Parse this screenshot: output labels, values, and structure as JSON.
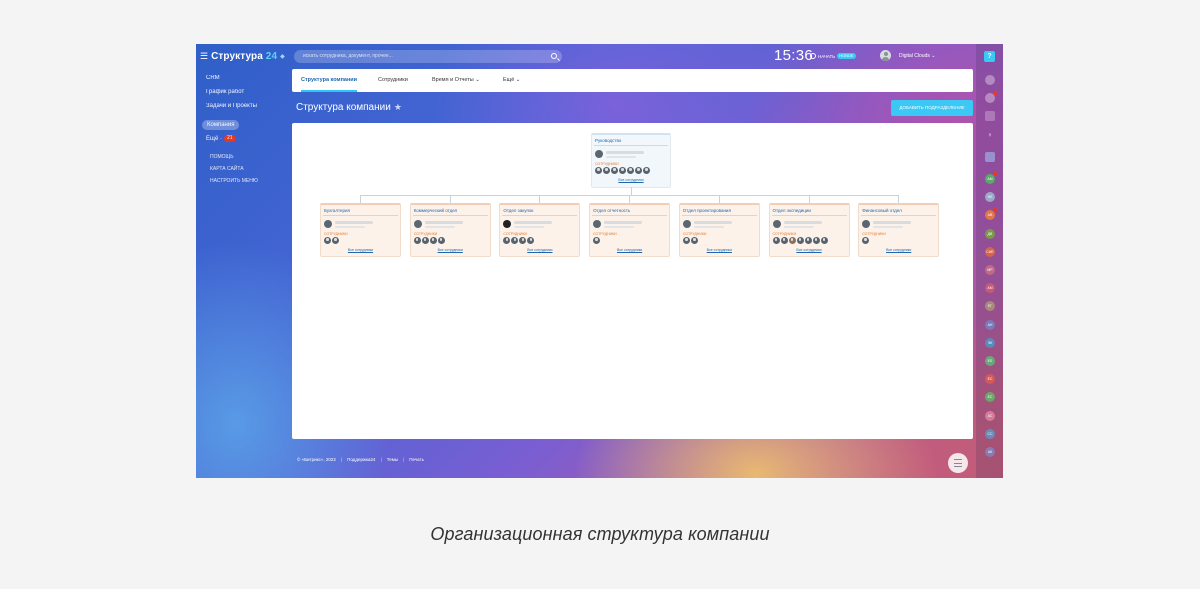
{
  "sidebar": {
    "logo_text": "Структура",
    "logo_num": "24",
    "items": [
      {
        "label": "CRM"
      },
      {
        "label": "График работ"
      },
      {
        "label": "Задачи и Проекты"
      },
      {
        "label": "Компания"
      },
      {
        "label": "Ещё"
      }
    ],
    "more_count": "21",
    "secondary": [
      {
        "label": "ПОМОЩЬ"
      },
      {
        "label": "КАРТА САЙТА"
      },
      {
        "label": "НАСТРОИТЬ МЕНЮ"
      }
    ]
  },
  "header": {
    "search_placeholder": "искать сотрудника, документ, прочее...",
    "clock": "15:36",
    "work_label": "НАЧАТЬ",
    "work_badge": "НОВОЕ",
    "user_name": "Digital Clouds"
  },
  "tabs": [
    {
      "label": "Структура компании"
    },
    {
      "label": "Сотрудники"
    },
    {
      "label": "Время и Отчеты"
    },
    {
      "label": "Ещё"
    }
  ],
  "page": {
    "title": "Структура компании",
    "add_button": "ДОБАВИТЬ ПОДРАЗДЕЛЕНИЕ"
  },
  "org": {
    "employees_label": "СОТРУДНИКИ",
    "all_link": "Все сотрудники",
    "root": {
      "name": "Руководство",
      "employee_count": 7
    },
    "departments": [
      {
        "name": "Бухгалтерия",
        "employee_count": 2
      },
      {
        "name": "Коммерческий отдел",
        "employee_count": 4
      },
      {
        "name": "Отдел закупок",
        "employee_count": 4
      },
      {
        "name": "Отдел отчетность",
        "employee_count": 1
      },
      {
        "name": "Отдел проектирования",
        "employee_count": 2
      },
      {
        "name": "Отдел экспедиции",
        "employee_count": 7
      },
      {
        "name": "Финансовый отдел",
        "employee_count": 1
      }
    ]
  },
  "footer": {
    "copyright": "© «Битрикс», 2022",
    "support": "Поддержка24",
    "themes": "Темы",
    "print": "Печать"
  },
  "rail": {
    "top_icon": "?",
    "avatars": [
      "АМ",
      "НЕ",
      "АВ",
      "ДВ",
      "СИЕ",
      "МР",
      "АМ",
      "ЕГ",
      "АН",
      "ЭК",
      "ЕЛ",
      "ЕС",
      "ЕС",
      "АС",
      "СС",
      "АК"
    ]
  },
  "caption": "Организационная структура компании"
}
